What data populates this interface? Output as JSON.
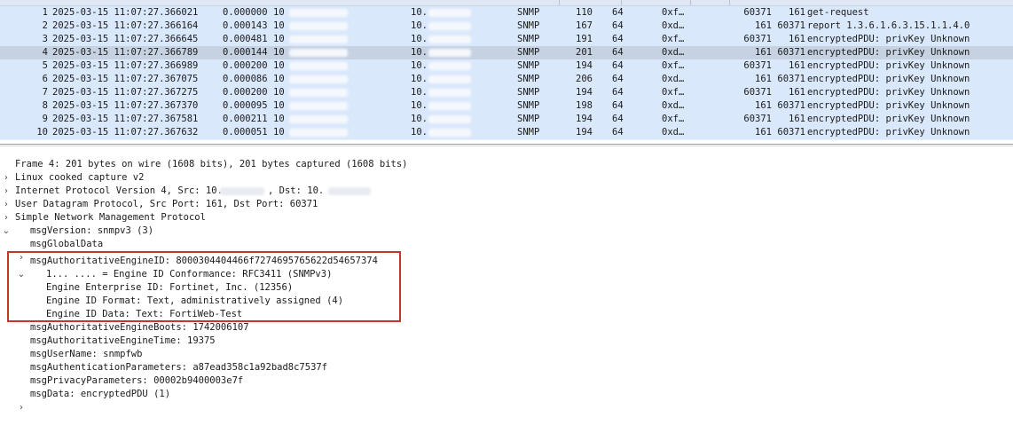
{
  "packet_list": {
    "rows": [
      {
        "no": "1",
        "time": "2025-03-15 11:07:27.366021",
        "delta": "0.000000",
        "src": "10",
        "dst": "10.",
        "protocol": "SNMP",
        "length": "110",
        "ttl": "64",
        "id": "0xf…",
        "sport": "60371",
        "dport": "161",
        "info": "get-request",
        "selected": false
      },
      {
        "no": "2",
        "time": "2025-03-15 11:07:27.366164",
        "delta": "0.000143",
        "src": "10",
        "dst": "10.",
        "protocol": "SNMP",
        "length": "167",
        "ttl": "64",
        "id": "0xd…",
        "sport": "161",
        "dport": "60371",
        "info": "report 1.3.6.1.6.3.15.1.1.4.0",
        "selected": false
      },
      {
        "no": "3",
        "time": "2025-03-15 11:07:27.366645",
        "delta": "0.000481",
        "src": "10",
        "dst": "10.",
        "protocol": "SNMP",
        "length": "191",
        "ttl": "64",
        "id": "0xf…",
        "sport": "60371",
        "dport": "161",
        "info": "encryptedPDU: privKey Unknown",
        "selected": false
      },
      {
        "no": "4",
        "time": "2025-03-15 11:07:27.366789",
        "delta": "0.000144",
        "src": "10",
        "dst": "10.",
        "protocol": "SNMP",
        "length": "201",
        "ttl": "64",
        "id": "0xd…",
        "sport": "161",
        "dport": "60371",
        "info": "encryptedPDU: privKey Unknown",
        "selected": true
      },
      {
        "no": "5",
        "time": "2025-03-15 11:07:27.366989",
        "delta": "0.000200",
        "src": "10",
        "dst": "10.",
        "protocol": "SNMP",
        "length": "194",
        "ttl": "64",
        "id": "0xf…",
        "sport": "60371",
        "dport": "161",
        "info": "encryptedPDU: privKey Unknown",
        "selected": false
      },
      {
        "no": "6",
        "time": "2025-03-15 11:07:27.367075",
        "delta": "0.000086",
        "src": "10",
        "dst": "10.",
        "protocol": "SNMP",
        "length": "206",
        "ttl": "64",
        "id": "0xd…",
        "sport": "161",
        "dport": "60371",
        "info": "encryptedPDU: privKey Unknown",
        "selected": false
      },
      {
        "no": "7",
        "time": "2025-03-15 11:07:27.367275",
        "delta": "0.000200",
        "src": "10",
        "dst": "10.",
        "protocol": "SNMP",
        "length": "194",
        "ttl": "64",
        "id": "0xf…",
        "sport": "60371",
        "dport": "161",
        "info": "encryptedPDU: privKey Unknown",
        "selected": false
      },
      {
        "no": "8",
        "time": "2025-03-15 11:07:27.367370",
        "delta": "0.000095",
        "src": "10",
        "dst": "10.",
        "protocol": "SNMP",
        "length": "198",
        "ttl": "64",
        "id": "0xd…",
        "sport": "161",
        "dport": "60371",
        "info": "encryptedPDU: privKey Unknown",
        "selected": false
      },
      {
        "no": "9",
        "time": "2025-03-15 11:07:27.367581",
        "delta": "0.000211",
        "src": "10",
        "dst": "10.",
        "protocol": "SNMP",
        "length": "194",
        "ttl": "64",
        "id": "0xf…",
        "sport": "60371",
        "dport": "161",
        "info": "encryptedPDU: privKey Unknown",
        "selected": false
      },
      {
        "no": "10",
        "time": "2025-03-15 11:07:27.367632",
        "delta": "0.000051",
        "src": "10",
        "dst": "10.",
        "protocol": "SNMP",
        "length": "194",
        "ttl": "64",
        "id": "0xd…",
        "sport": "161",
        "dport": "60371",
        "info": "encryptedPDU: privKey Unknown",
        "selected": false
      }
    ]
  },
  "details": {
    "frame": "Frame 4: 201 bytes on wire (1608 bits), 201 bytes captured (1608 bits)",
    "linux_cooked": "Linux cooked capture v2",
    "ip_prefix": "Internet Protocol Version 4, Src: 10.",
    "ip_mid": ", Dst: 10.",
    "udp": "User Datagram Protocol, Src Port: 161, Dst Port: 60371",
    "snmp": "Simple Network Management Protocol",
    "msg_version": "msgVersion: snmpv3 (3)",
    "msg_global_data": "msgGlobalData",
    "engine_id": "msgAuthoritativeEngineID: 8000304404466f7274695765622d54657374",
    "engine_conformance": "1... .... = Engine ID Conformance: RFC3411 (SNMPv3)",
    "engine_enterprise": "Engine Enterprise ID: Fortinet, Inc. (12356)",
    "engine_format": "Engine ID Format: Text, administratively assigned (4)",
    "engine_data": "Engine ID Data: Text: FortiWeb-Test",
    "engine_boots": "msgAuthoritativeEngineBoots: 1742006107",
    "engine_time": "msgAuthoritativeEngineTime: 19375",
    "user_name": "msgUserName: snmpfwb",
    "auth_params": "msgAuthenticationParameters: a87ead358c1a92bad8c7537f",
    "priv_params": "msgPrivacyParameters: 00002b9400003e7f",
    "msg_data": "msgData: encryptedPDU (1)"
  },
  "icons": {
    "collapsed": "chevron-right-icon",
    "expanded": "chevron-down-icon"
  },
  "colors": {
    "row_bg": "#dae8fc",
    "selected_row_bg": "#c6d2e2",
    "highlight_border": "#c0392b"
  }
}
